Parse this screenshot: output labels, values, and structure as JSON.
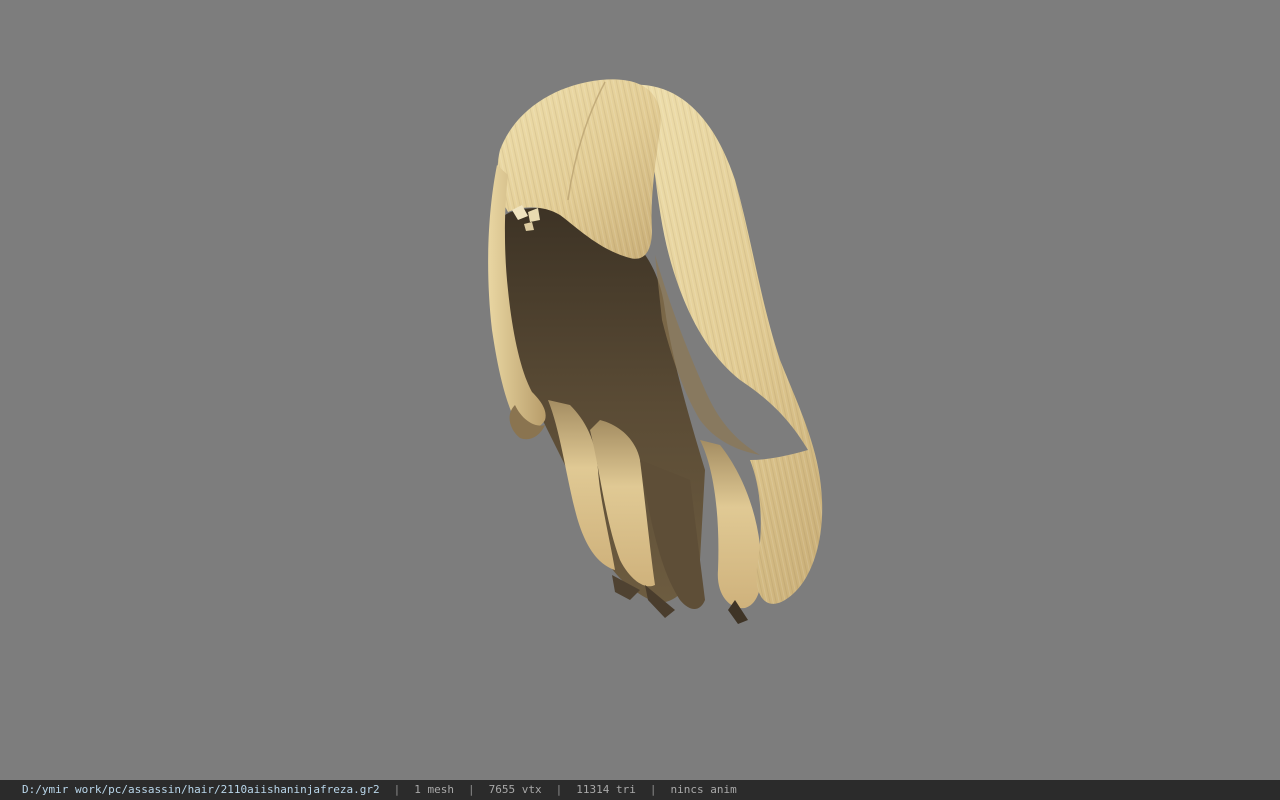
{
  "viewport": {
    "background_color": "#7d7d7d",
    "model_colors": {
      "hair_light": "#e6d29d",
      "hair_mid": "#c9b07a",
      "hair_shadow": "#5a4c37",
      "hair_dark": "#3e3426"
    }
  },
  "statusbar": {
    "file_path": "D:/ymir work/pc/assassin/hair/2110aiishaninjafreza.gr2",
    "separator": "|",
    "mesh_count": "1 mesh",
    "vertex_count": "7655 vtx",
    "triangle_count": "11314 tri",
    "anim_status": "nincs anim"
  }
}
